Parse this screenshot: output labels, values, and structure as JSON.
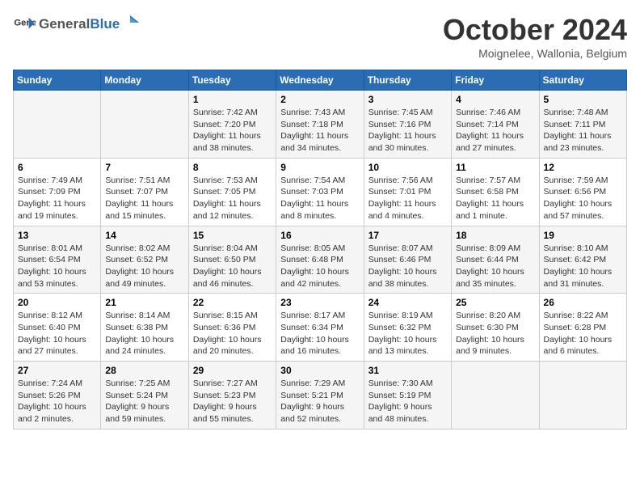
{
  "logo": {
    "text_general": "General",
    "text_blue": "Blue"
  },
  "title": "October 2024",
  "location": "Moignelee, Wallonia, Belgium",
  "weekdays": [
    "Sunday",
    "Monday",
    "Tuesday",
    "Wednesday",
    "Thursday",
    "Friday",
    "Saturday"
  ],
  "weeks": [
    [
      {
        "day": "",
        "sunrise": "",
        "sunset": "",
        "daylight": ""
      },
      {
        "day": "",
        "sunrise": "",
        "sunset": "",
        "daylight": ""
      },
      {
        "day": "1",
        "sunrise": "Sunrise: 7:42 AM",
        "sunset": "Sunset: 7:20 PM",
        "daylight": "Daylight: 11 hours and 38 minutes."
      },
      {
        "day": "2",
        "sunrise": "Sunrise: 7:43 AM",
        "sunset": "Sunset: 7:18 PM",
        "daylight": "Daylight: 11 hours and 34 minutes."
      },
      {
        "day": "3",
        "sunrise": "Sunrise: 7:45 AM",
        "sunset": "Sunset: 7:16 PM",
        "daylight": "Daylight: 11 hours and 30 minutes."
      },
      {
        "day": "4",
        "sunrise": "Sunrise: 7:46 AM",
        "sunset": "Sunset: 7:14 PM",
        "daylight": "Daylight: 11 hours and 27 minutes."
      },
      {
        "day": "5",
        "sunrise": "Sunrise: 7:48 AM",
        "sunset": "Sunset: 7:11 PM",
        "daylight": "Daylight: 11 hours and 23 minutes."
      }
    ],
    [
      {
        "day": "6",
        "sunrise": "Sunrise: 7:49 AM",
        "sunset": "Sunset: 7:09 PM",
        "daylight": "Daylight: 11 hours and 19 minutes."
      },
      {
        "day": "7",
        "sunrise": "Sunrise: 7:51 AM",
        "sunset": "Sunset: 7:07 PM",
        "daylight": "Daylight: 11 hours and 15 minutes."
      },
      {
        "day": "8",
        "sunrise": "Sunrise: 7:53 AM",
        "sunset": "Sunset: 7:05 PM",
        "daylight": "Daylight: 11 hours and 12 minutes."
      },
      {
        "day": "9",
        "sunrise": "Sunrise: 7:54 AM",
        "sunset": "Sunset: 7:03 PM",
        "daylight": "Daylight: 11 hours and 8 minutes."
      },
      {
        "day": "10",
        "sunrise": "Sunrise: 7:56 AM",
        "sunset": "Sunset: 7:01 PM",
        "daylight": "Daylight: 11 hours and 4 minutes."
      },
      {
        "day": "11",
        "sunrise": "Sunrise: 7:57 AM",
        "sunset": "Sunset: 6:58 PM",
        "daylight": "Daylight: 11 hours and 1 minute."
      },
      {
        "day": "12",
        "sunrise": "Sunrise: 7:59 AM",
        "sunset": "Sunset: 6:56 PM",
        "daylight": "Daylight: 10 hours and 57 minutes."
      }
    ],
    [
      {
        "day": "13",
        "sunrise": "Sunrise: 8:01 AM",
        "sunset": "Sunset: 6:54 PM",
        "daylight": "Daylight: 10 hours and 53 minutes."
      },
      {
        "day": "14",
        "sunrise": "Sunrise: 8:02 AM",
        "sunset": "Sunset: 6:52 PM",
        "daylight": "Daylight: 10 hours and 49 minutes."
      },
      {
        "day": "15",
        "sunrise": "Sunrise: 8:04 AM",
        "sunset": "Sunset: 6:50 PM",
        "daylight": "Daylight: 10 hours and 46 minutes."
      },
      {
        "day": "16",
        "sunrise": "Sunrise: 8:05 AM",
        "sunset": "Sunset: 6:48 PM",
        "daylight": "Daylight: 10 hours and 42 minutes."
      },
      {
        "day": "17",
        "sunrise": "Sunrise: 8:07 AM",
        "sunset": "Sunset: 6:46 PM",
        "daylight": "Daylight: 10 hours and 38 minutes."
      },
      {
        "day": "18",
        "sunrise": "Sunrise: 8:09 AM",
        "sunset": "Sunset: 6:44 PM",
        "daylight": "Daylight: 10 hours and 35 minutes."
      },
      {
        "day": "19",
        "sunrise": "Sunrise: 8:10 AM",
        "sunset": "Sunset: 6:42 PM",
        "daylight": "Daylight: 10 hours and 31 minutes."
      }
    ],
    [
      {
        "day": "20",
        "sunrise": "Sunrise: 8:12 AM",
        "sunset": "Sunset: 6:40 PM",
        "daylight": "Daylight: 10 hours and 27 minutes."
      },
      {
        "day": "21",
        "sunrise": "Sunrise: 8:14 AM",
        "sunset": "Sunset: 6:38 PM",
        "daylight": "Daylight: 10 hours and 24 minutes."
      },
      {
        "day": "22",
        "sunrise": "Sunrise: 8:15 AM",
        "sunset": "Sunset: 6:36 PM",
        "daylight": "Daylight: 10 hours and 20 minutes."
      },
      {
        "day": "23",
        "sunrise": "Sunrise: 8:17 AM",
        "sunset": "Sunset: 6:34 PM",
        "daylight": "Daylight: 10 hours and 16 minutes."
      },
      {
        "day": "24",
        "sunrise": "Sunrise: 8:19 AM",
        "sunset": "Sunset: 6:32 PM",
        "daylight": "Daylight: 10 hours and 13 minutes."
      },
      {
        "day": "25",
        "sunrise": "Sunrise: 8:20 AM",
        "sunset": "Sunset: 6:30 PM",
        "daylight": "Daylight: 10 hours and 9 minutes."
      },
      {
        "day": "26",
        "sunrise": "Sunrise: 8:22 AM",
        "sunset": "Sunset: 6:28 PM",
        "daylight": "Daylight: 10 hours and 6 minutes."
      }
    ],
    [
      {
        "day": "27",
        "sunrise": "Sunrise: 7:24 AM",
        "sunset": "Sunset: 5:26 PM",
        "daylight": "Daylight: 10 hours and 2 minutes."
      },
      {
        "day": "28",
        "sunrise": "Sunrise: 7:25 AM",
        "sunset": "Sunset: 5:24 PM",
        "daylight": "Daylight: 9 hours and 59 minutes."
      },
      {
        "day": "29",
        "sunrise": "Sunrise: 7:27 AM",
        "sunset": "Sunset: 5:23 PM",
        "daylight": "Daylight: 9 hours and 55 minutes."
      },
      {
        "day": "30",
        "sunrise": "Sunrise: 7:29 AM",
        "sunset": "Sunset: 5:21 PM",
        "daylight": "Daylight: 9 hours and 52 minutes."
      },
      {
        "day": "31",
        "sunrise": "Sunrise: 7:30 AM",
        "sunset": "Sunset: 5:19 PM",
        "daylight": "Daylight: 9 hours and 48 minutes."
      },
      {
        "day": "",
        "sunrise": "",
        "sunset": "",
        "daylight": ""
      },
      {
        "day": "",
        "sunrise": "",
        "sunset": "",
        "daylight": ""
      }
    ]
  ]
}
